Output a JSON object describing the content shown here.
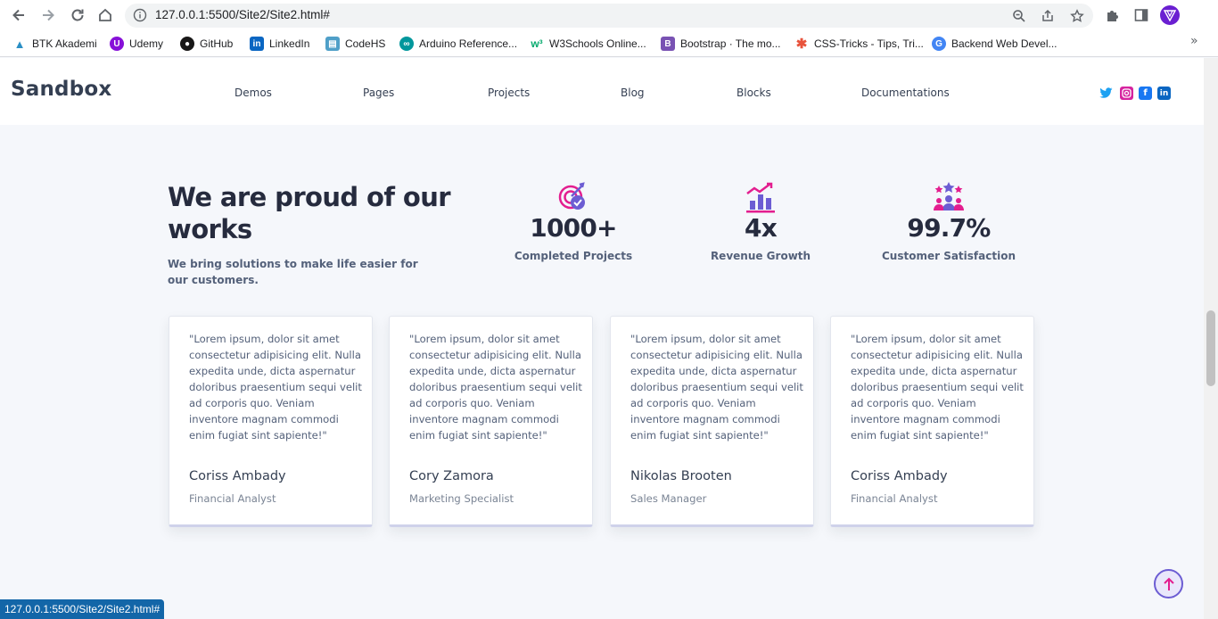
{
  "browser": {
    "url": "127.0.0.1:5500/Site2/Site2.html#",
    "icons": {
      "back": "arrow-left-icon",
      "forward": "arrow-right-icon",
      "reload": "reload-icon",
      "home": "home-icon",
      "info": "info-icon",
      "zoom": "zoom-icon",
      "share": "share-icon",
      "star": "star-icon",
      "extensions": "puzzle-icon",
      "sidepanel": "side-panel-icon"
    },
    "bookmarks": [
      {
        "label": "BTK Akademi",
        "color": "#2a8fc5"
      },
      {
        "label": "Udemy",
        "color": "#8710d8"
      },
      {
        "label": "GitHub",
        "color": "#181717"
      },
      {
        "label": "LinkedIn",
        "color": "#0a66c2"
      },
      {
        "label": "CodeHS",
        "color": "#4f9fc8"
      },
      {
        "label": "Arduino Reference...",
        "color": "#00979c"
      },
      {
        "label": "W3Schools Online...",
        "color": "#04aa6d"
      },
      {
        "label": "Bootstrap · The mo...",
        "color": "#7952b3"
      },
      {
        "label": "CSS-Tricks - Tips, Tri...",
        "color": "#e8533c"
      },
      {
        "label": "Backend Web Devel...",
        "color": "#4285f4"
      }
    ],
    "more": "»"
  },
  "site": {
    "brand": "Sandbox",
    "menu": [
      "Demos",
      "Pages",
      "Projects",
      "Blog",
      "Blocks",
      "Documentations"
    ],
    "social": [
      {
        "name": "twitter-icon",
        "color": "#1da1f2"
      },
      {
        "name": "instagram-icon",
        "color": "#d6249f"
      },
      {
        "name": "facebook-icon",
        "color": "#1877f2"
      },
      {
        "name": "linkedin-icon",
        "color": "#0a66c2"
      }
    ]
  },
  "proud": {
    "title": "We are proud of our works",
    "subtitle": "We bring solutions to make life easier for our customers."
  },
  "stats": [
    {
      "value": "1000+",
      "label": "Completed Projects",
      "icon": "target-icon"
    },
    {
      "value": "4x",
      "label": "Revenue Growth",
      "icon": "growth-chart-icon"
    },
    {
      "value": "99.7%",
      "label": "Customer Satisfaction",
      "icon": "team-stars-icon"
    }
  ],
  "testimonials": [
    {
      "quote": "\"Lorem ipsum, dolor sit amet consectetur adipisicing elit. Nulla expedita unde, dicta aspernatur doloribus praesentium sequi velit ad corporis quo. Veniam inventore magnam commodi enim fugiat sint sapiente!\"",
      "name": "Coriss Ambady",
      "role": "Financial Analyst"
    },
    {
      "quote": "\"Lorem ipsum, dolor sit amet consectetur adipisicing elit. Nulla expedita unde, dicta aspernatur doloribus praesentium sequi velit ad corporis quo. Veniam inventore magnam commodi enim fugiat sint sapiente!\"",
      "name": "Cory Zamora",
      "role": "Marketing Specialist"
    },
    {
      "quote": "\"Lorem ipsum, dolor sit amet consectetur adipisicing elit. Nulla expedita unde, dicta aspernatur doloribus praesentium sequi velit ad corporis quo. Veniam inventore magnam commodi enim fugiat sint sapiente!\"",
      "name": "Nikolas Brooten",
      "role": "Sales Manager"
    },
    {
      "quote": "\"Lorem ipsum, dolor sit amet consectetur adipisicing elit. Nulla expedita unde, dicta aspernatur doloribus praesentium sequi velit ad corporis quo. Veniam inventore magnam commodi enim fugiat sint sapiente!\"",
      "name": "Coriss Ambady",
      "role": "Financial Analyst"
    }
  ],
  "status_bar": "127.0.0.1:5500/Site2/Site2.html#",
  "colors": {
    "accent": "#6c5dd3",
    "pink": "#e31e8f",
    "heading": "#262b3e"
  }
}
